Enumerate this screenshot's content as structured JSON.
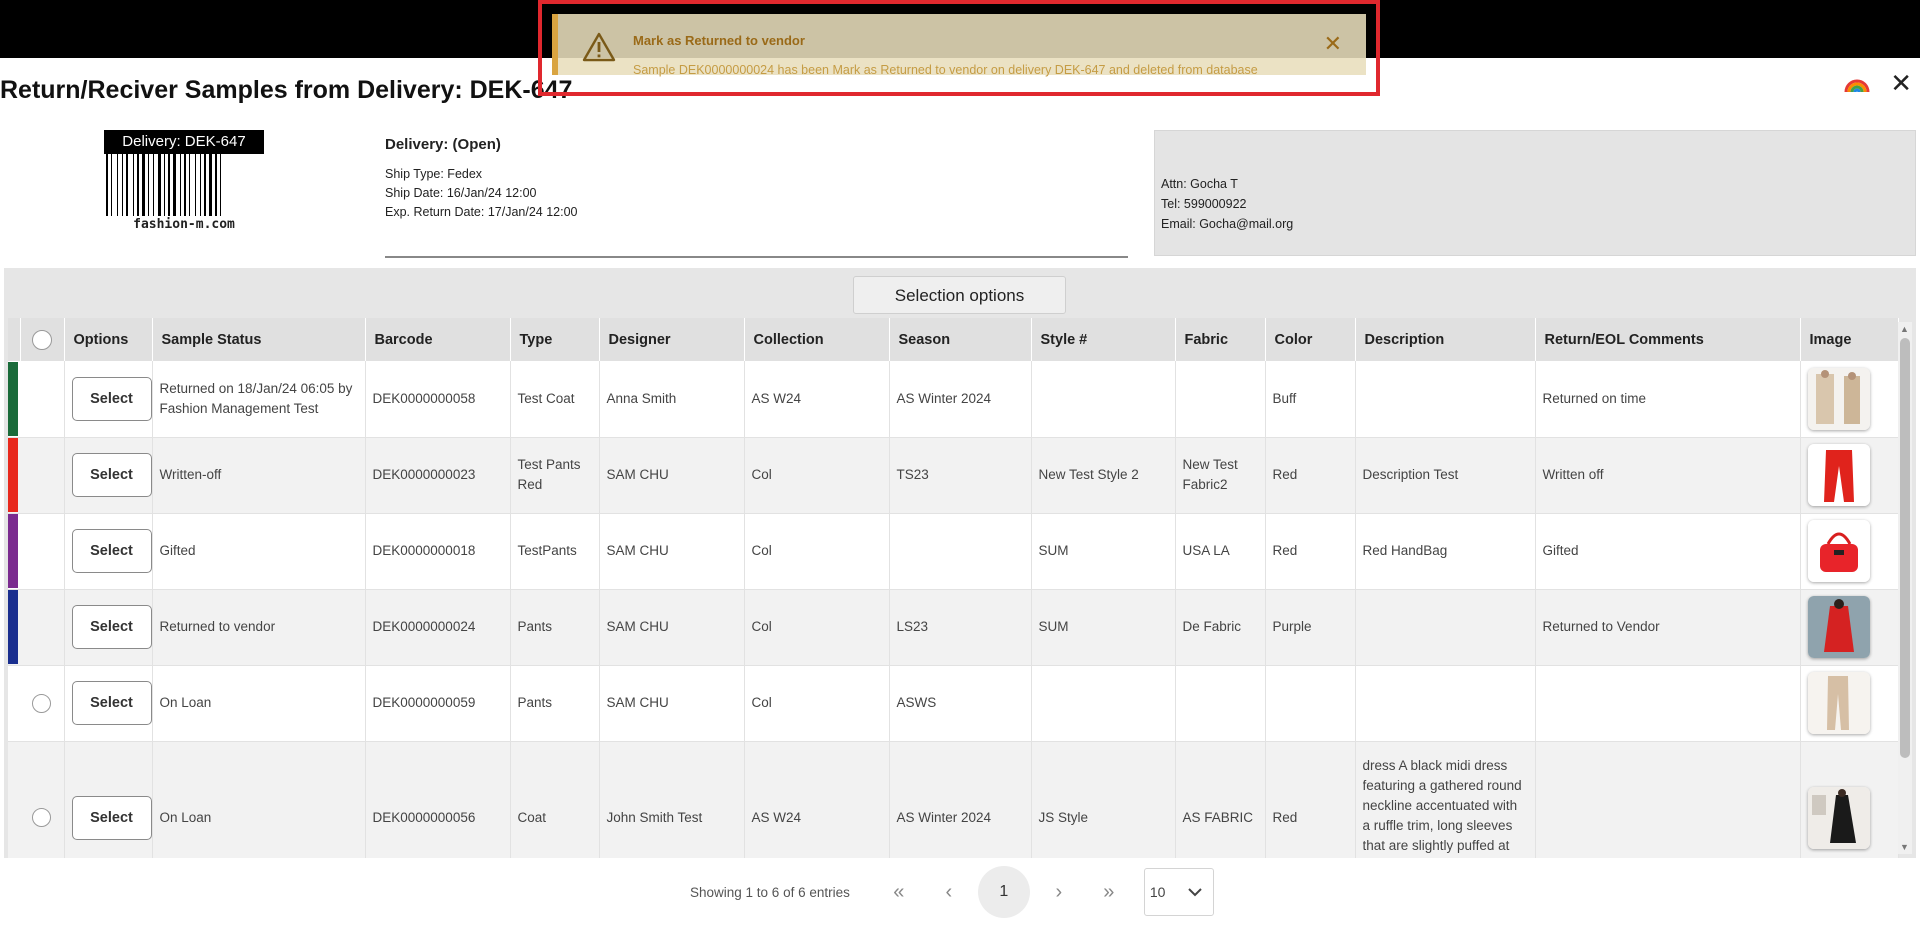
{
  "page": {
    "title": "Return/Reciver Samples from Delivery: DEK-647"
  },
  "toast": {
    "title": "Mark as Returned to vendor",
    "message": "Sample DEK0000000024 has been Mark as Returned to vendor on delivery DEK-647 and deleted from database",
    "close": "✕",
    "accent_color": "#d9a441"
  },
  "header_actions": {
    "close": "✕"
  },
  "delivery": {
    "label": "Delivery: DEK-647",
    "site": "fashion-m.com",
    "status": "Delivery: (Open)",
    "ship_type": "Ship Type: Fedex",
    "ship_date": "Ship Date: 16/Jan/24 12:00",
    "return_date": "Exp. Return Date: 17/Jan/24 12:00"
  },
  "contact": {
    "attn": "Attn: Gocha T",
    "tel": "Tel: 599000922",
    "email": "Email: Gocha@mail.org"
  },
  "selection_options": "Selection options",
  "columns": [
    "Options",
    "Sample Status",
    "Barcode",
    "Type",
    "Designer",
    "Collection",
    "Season",
    "Style #",
    "Fabric",
    "Color",
    "Description",
    "Return/EOL Comments",
    "Image"
  ],
  "rows": [
    {
      "stripe": "#1a6b3a",
      "select": "Select",
      "status": "Returned on 18/Jan/24 06:05 by Fashion Management Test",
      "barcode": "DEK0000000058",
      "type": "Test Coat",
      "designer": "Anna Smith",
      "collection": "AS W24",
      "season": "AS Winter 2024",
      "style": "",
      "fabric": "",
      "color": "Buff",
      "description": "",
      "comments": "Returned on time",
      "image": "beige-outfit-thumbnail"
    },
    {
      "stripe": "#e8281c",
      "select": "Select",
      "status": "Written-off",
      "barcode": "DEK0000000023",
      "type": "Test Pants Red",
      "designer": "SAM CHU",
      "collection": "Col",
      "season": "TS23",
      "style": "New Test Style 2",
      "fabric": "New Test Fabric2",
      "color": "Red",
      "description": "Description Test",
      "comments": "Written off",
      "image": "red-pants-thumbnail"
    },
    {
      "stripe": "#7b2b8f",
      "select": "Select",
      "status": "Gifted",
      "barcode": "DEK0000000018",
      "type": "TestPants",
      "designer": "SAM CHU",
      "collection": "Col",
      "season": "",
      "style": "SUM",
      "fabric": "USA LA",
      "color": "Red",
      "description": "Red HandBag",
      "comments": "Gifted",
      "image": "red-handbag-thumbnail"
    },
    {
      "stripe": "#1a2f8f",
      "select": "Select",
      "status": "Returned to vendor",
      "barcode": "DEK0000000024",
      "type": "Pants",
      "designer": "SAM CHU",
      "collection": "Col",
      "season": "LS23",
      "style": "SUM",
      "fabric": "De Fabric",
      "color": "Purple",
      "description": "",
      "comments": "Returned to Vendor",
      "image": "red-coat-thumbnail"
    },
    {
      "stripe": "",
      "select": "Select",
      "status": "On Loan",
      "barcode": "DEK0000000059",
      "type": "Pants",
      "designer": "SAM CHU",
      "collection": "Col",
      "season": "ASWS",
      "style": "",
      "fabric": "",
      "color": "",
      "description": "",
      "comments": "",
      "image": "beige-pants-thumbnail"
    },
    {
      "stripe": "",
      "select": "Select",
      "status": "On Loan",
      "barcode": "DEK0000000056",
      "type": "Coat",
      "designer": "John Smith Test",
      "collection": "AS W24",
      "season": "AS Winter 2024",
      "style": "JS Style",
      "fabric": "AS FABRIC",
      "color": "Red",
      "description": "dress A black midi dress featuring a gathered round neckline accentuated with a ruffle trim, long sleeves that are slightly puffed at the shoulders, an elasticated",
      "comments": "",
      "image": "black-dress-thumbnail"
    }
  ],
  "pagination": {
    "info": "Showing 1 to 6 of 6 entries",
    "first": "«",
    "prev": "‹",
    "current": "1",
    "next": "›",
    "last": "»",
    "page_size": "10"
  }
}
